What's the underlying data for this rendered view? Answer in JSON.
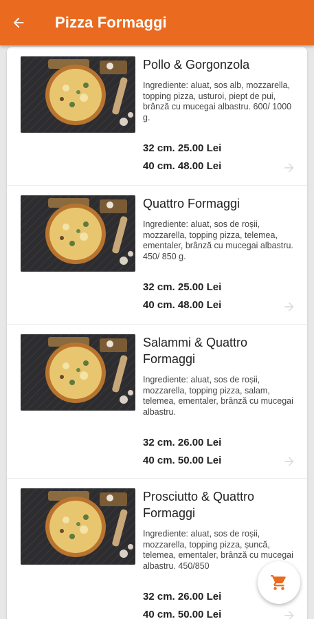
{
  "header": {
    "title": "Pizza Formaggi",
    "accent_color": "#ea6a1f",
    "back_icon": "arrow-left-icon"
  },
  "items": [
    {
      "name": "Pollo & Gorgonzola",
      "description": "Ingrediente: aluat, sos alb, mozzarella, topping pizza, usturoi, piept de pui, brânză cu mucegai albastru. 600/ 1000 g.",
      "price_small": "32 cm. 25.00 Lei",
      "price_large": "40 cm. 48.00 Lei"
    },
    {
      "name": "Quattro Formaggi",
      "description": "Ingrediente: aluat, sos de roșii, mozzarella, topping pizza, telemea, ementaler, brânză cu mucegai albastru. 450/ 850 g.",
      "price_small": "32 cm. 25.00 Lei",
      "price_large": "40 cm. 48.00 Lei"
    },
    {
      "name": "Salammi & Quattro Formaggi",
      "description": "Ingrediente: aluat, sos de roșii, mozzarella, topping pizza, salam, telemea, ementaler, brânză cu mucegai albastru.",
      "price_small": "32 cm. 26.00 Lei",
      "price_large": "40 cm. 50.00 Lei"
    },
    {
      "name": "Prosciutto & Quattro Formaggi",
      "description": "Ingrediente: aluat, sos de roșii, mozzarella, topping pizza, șuncă, telemea, ementaler, brânză cu mucegai albastru. 450/850",
      "price_small": "32 cm. 26.00 Lei",
      "price_large": "40 cm. 50.00 Lei"
    }
  ],
  "cart_icon": "cart-icon"
}
